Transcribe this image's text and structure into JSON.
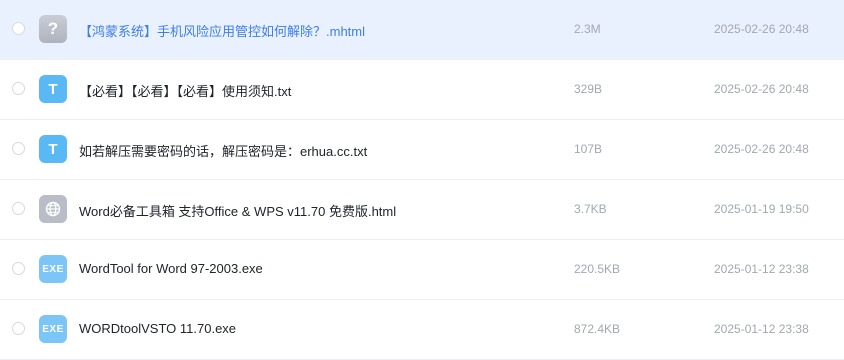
{
  "files": [
    {
      "icon": "question-file-icon",
      "icon_text": "?",
      "name": "【鸿蒙系统】手机风险应用管控如何解除？.mhtml",
      "size": "2.3M",
      "date": "2025-02-26 20:48"
    },
    {
      "icon": "txt-file-icon",
      "icon_text": "T",
      "name": "【必看】【必看】【必看】使用须知.txt",
      "size": "329B",
      "date": "2025-02-26 20:48"
    },
    {
      "icon": "txt-file-icon",
      "icon_text": "T",
      "name": "如若解压需要密码的话，解压密码是：erhua.cc.txt",
      "size": "107B",
      "date": "2025-02-26 20:48"
    },
    {
      "icon": "html-file-icon",
      "icon_text": "",
      "name": "Word必备工具箱 支持Office & WPS v11.70 免费版.html",
      "size": "3.7KB",
      "date": "2025-01-19 19:50"
    },
    {
      "icon": "exe-file-icon",
      "icon_text": "EXE",
      "name": "WordTool for Word 97-2003.exe",
      "size": "220.5KB",
      "date": "2025-01-12 23:38"
    },
    {
      "icon": "exe-file-icon",
      "icon_text": "EXE",
      "name": "WORDtoolVSTO 11.70.exe",
      "size": "872.4KB",
      "date": "2025-01-12 23:38"
    }
  ],
  "colors": {
    "selected_row_bg": "#eaf1fe",
    "selected_name": "#3d7ee8",
    "txt_icon": "#5ab8f5",
    "exe_icon": "#7cc6f7",
    "meta_text": "#a2a7b0"
  }
}
